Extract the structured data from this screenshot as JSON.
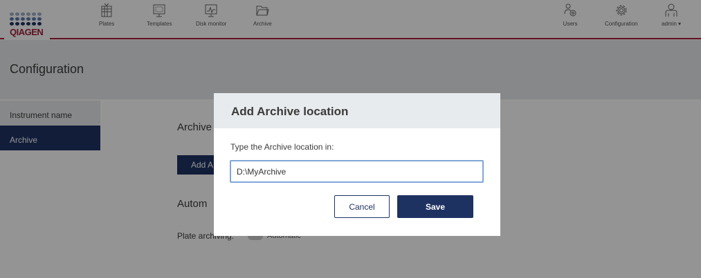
{
  "brand": {
    "logo_text": "QIAGEN",
    "accent_color": "#a31e36",
    "primary_color": "#1e3262"
  },
  "nav": {
    "items": [
      {
        "label": "Plates",
        "icon": "plates-icon"
      },
      {
        "label": "Templates",
        "icon": "templates-icon"
      },
      {
        "label": "Disk monitor",
        "icon": "disk-monitor-icon"
      },
      {
        "label": "Archive",
        "icon": "folder-icon"
      }
    ],
    "right_items": [
      {
        "label": "Users",
        "icon": "users-icon"
      },
      {
        "label": "Configuration",
        "icon": "gear-icon"
      },
      {
        "label": "admin ▾",
        "icon": "user-icon"
      }
    ]
  },
  "page": {
    "title": "Configuration",
    "sidebar": [
      {
        "label": "Instrument name"
      },
      {
        "label": "Archive"
      }
    ],
    "archive_section_title": "Archive",
    "add_button_label": "Add A",
    "automatic_section_title": "Autom",
    "plate_archiving_label": "Plate archiving:",
    "toggle_label": "Automatic"
  },
  "modal": {
    "title": "Add Archive location",
    "label": "Type the Archive location in:",
    "input_value": "D:\\MyArchive",
    "cancel_label": "Cancel",
    "save_label": "Save"
  }
}
